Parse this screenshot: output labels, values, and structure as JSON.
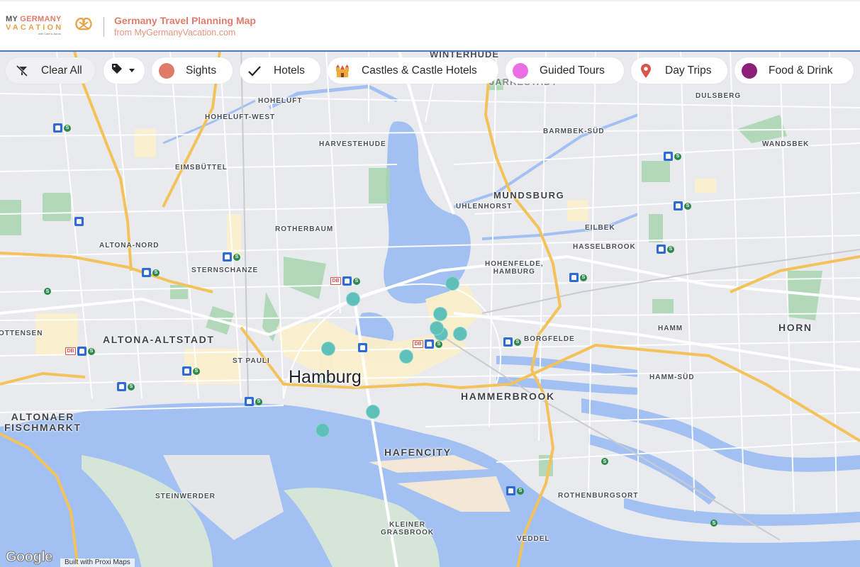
{
  "header": {
    "logo": {
      "line1_a": "MY ",
      "line1_b": "GERMANY",
      "line2": "VACATION",
      "tagline": "with Cate & Aaron"
    },
    "title": "Germany Travel Planning Map",
    "subtitle": "from MyGermanyVacation.com"
  },
  "filters": {
    "clear_all": "Clear All",
    "tag_dropdown_icon": "tag-icon",
    "items": [
      {
        "label": "Sights",
        "icon": "dot",
        "color": "#e07a6a"
      },
      {
        "label": "Hotels",
        "icon": "checkmark"
      },
      {
        "label": "Castles & Castle Hotels",
        "icon": "castle"
      },
      {
        "label": "Guided Tours",
        "icon": "dot",
        "color": "#ea6ee6"
      },
      {
        "label": "Day Trips",
        "icon": "map-pin"
      },
      {
        "label": "Food & Drink",
        "icon": "dot",
        "color": "#8e1f78"
      }
    ]
  },
  "map": {
    "city_label": "Hamburg",
    "marker_color": "#5ec0b8",
    "districts": {
      "winterhude": "WINTERHUDE",
      "jarrestadt": "JARRESTADT",
      "dulsberg": "DULSBERG",
      "hoheluft": "HOHELUFT",
      "hoheluft_west": "HOHELUFT-WEST",
      "barmbek_sud": "BARMBEK-SÜD",
      "wandsbek": "WANDSBEK",
      "harvestehude": "HARVESTEHUDE",
      "eimsbuttel": "EIMSBÜTTEL",
      "mundsburg": "MUNDSBURG",
      "uhlenhorst": "UHLENHORST",
      "rotherbaum": "ROTHERBAUM",
      "eilbek": "EILBEK",
      "altona_nord": "ALTONA-NORD",
      "hasselbrook": "HASSELBROOK",
      "sternschanze": "STERNSCHANZE",
      "hohenfelde": "HOHENFELDE,",
      "hohenfelde2": "HAMBURG",
      "ottensen": "OTTENSEN",
      "altona_altstadt": "ALTONA-ALTSTADT",
      "hamm": "HAMM",
      "horn": "HORN",
      "borgfelde": "BORGFELDE",
      "st_pauli": "ST PAULI",
      "hamm_sud": "HAMM-SÜD",
      "hammerbrook": "HAMMERBROOK",
      "altonaer1": "ALTONAER",
      "altonaer2": "FISCHMARKT",
      "hafencity": "HAFENCITY",
      "rothenburgsort": "ROTHENBURGSORT",
      "steinwerder": "STEINWERDER",
      "kleiner1": "KLEINER",
      "kleiner2": "GRASBROOK",
      "veddel": "VEDDEL"
    },
    "station_labels": {
      "db": "DB",
      "sbahn": "S"
    },
    "markers_count": 11
  },
  "footer": {
    "google": "Google",
    "attribution": "Built with Proxi Maps"
  }
}
